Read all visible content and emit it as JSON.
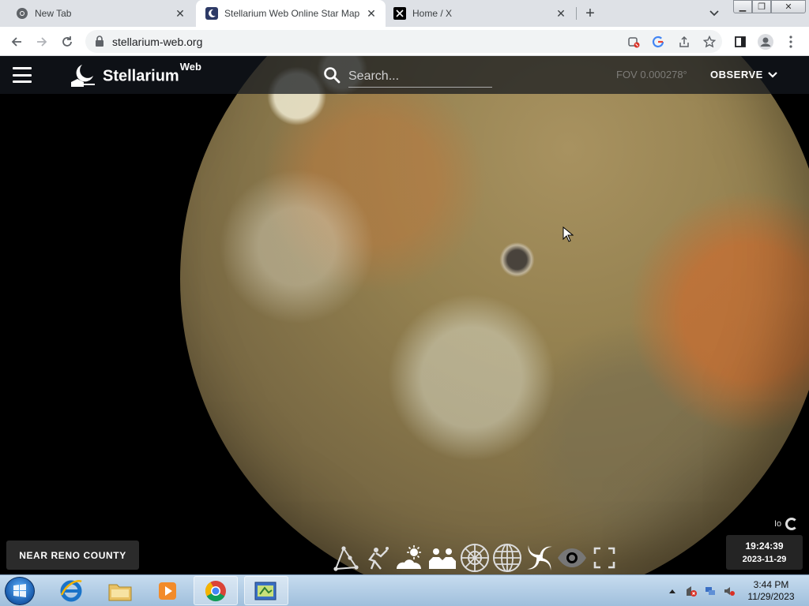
{
  "browser": {
    "tabs": [
      {
        "title": "New Tab",
        "icon": "chrome-icon",
        "active": false
      },
      {
        "title": "Stellarium Web Online Star Map",
        "icon": "stellarium-favicon",
        "active": true
      },
      {
        "title": "Home / X",
        "icon": "x-logo-icon",
        "active": false
      }
    ],
    "url": "stellarium-web.org"
  },
  "app": {
    "brand_name": "Stellarium",
    "brand_suffix": "Web",
    "search": {
      "placeholder": "Search..."
    },
    "fov_label": "FOV 0.000278°",
    "observe_label": "OBSERVE",
    "location_label": "NEAR RENO COUNTY",
    "selected_object": "Io",
    "time": "19:24:39",
    "date": "2023-11-29",
    "tools": [
      {
        "name": "constellation-lines-icon"
      },
      {
        "name": "constellation-art-icon"
      },
      {
        "name": "atmosphere-icon"
      },
      {
        "name": "landscape-icon"
      },
      {
        "name": "azimuthal-grid-icon"
      },
      {
        "name": "equatorial-grid-icon"
      },
      {
        "name": "deep-sky-objects-icon"
      },
      {
        "name": "night-mode-eye-icon"
      },
      {
        "name": "fullscreen-icon"
      }
    ]
  },
  "taskbar": {
    "clock_time": "3:44 PM",
    "clock_date": "11/29/2023"
  }
}
